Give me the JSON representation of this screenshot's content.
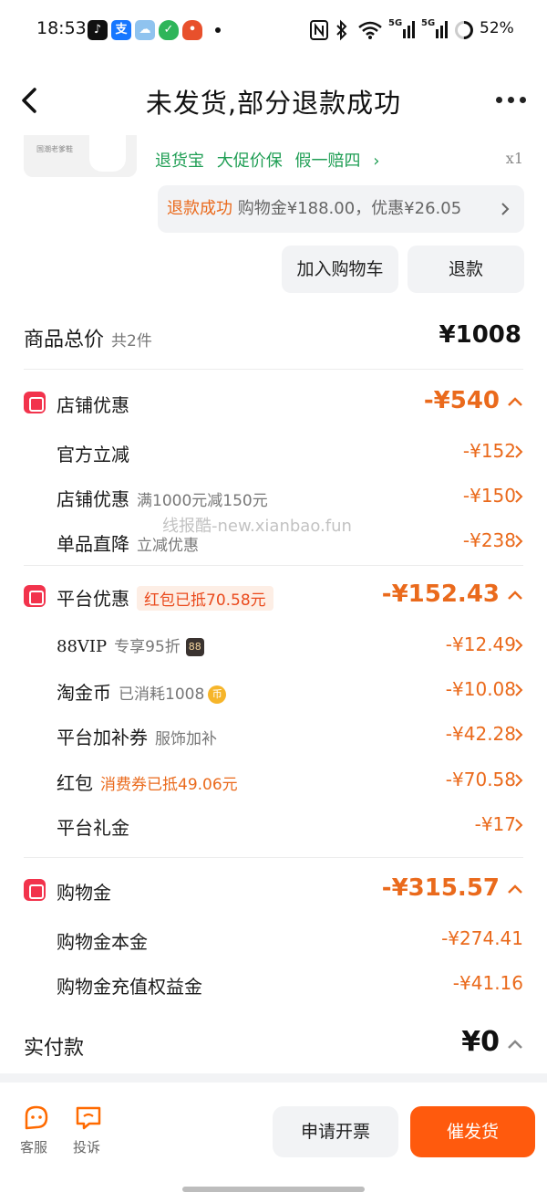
{
  "status_bar": {
    "time": "18:53",
    "battery": "52%",
    "signal_labels": [
      "5G",
      "5G"
    ],
    "app_icons": [
      "tiktok-icon",
      "alipay-icon",
      "weather-icon",
      "security-icon",
      "taobao-icon"
    ]
  },
  "header": {
    "title": "未发货,部分退款成功"
  },
  "product": {
    "thumb_text": "国潮老爹鞋",
    "tags": [
      "退货宝",
      "大促价保",
      "假一赔四"
    ],
    "quantity": "x1"
  },
  "refund": {
    "status": "退款成功",
    "detail": "购物金¥188.00，优惠¥26.05"
  },
  "actions": {
    "add_cart": "加入购物车",
    "refund": "退款"
  },
  "summary": {
    "label": "商品总价",
    "count": "共2件",
    "amount": "¥1008"
  },
  "store_discount": {
    "label": "店铺优惠",
    "amount": "-¥540",
    "items": [
      {
        "label": "官方立减",
        "note": "",
        "amount": "-¥152"
      },
      {
        "label": "店铺优惠",
        "note": "满1000元减150元",
        "amount": "-¥150"
      },
      {
        "label": "单品直降",
        "note": "立减优惠",
        "amount": "-¥238"
      }
    ]
  },
  "watermark": "线报酷-new.xianbao.fun",
  "platform_discount": {
    "label": "平台优惠",
    "tag": "红包已抵70.58元",
    "amount": "-¥152.43",
    "items": [
      {
        "label": "88VIP",
        "note": "专享95折",
        "badge": "88",
        "amount": "-¥12.49"
      },
      {
        "label": "淘金币",
        "note": "已消耗1008",
        "coin": "币",
        "amount": "-¥10.08"
      },
      {
        "label": "平台加补券",
        "note": "服饰加补",
        "amount": "-¥42.28"
      },
      {
        "label": "红包",
        "note_orange": "消费券已抵49.06元",
        "amount": "-¥70.58"
      },
      {
        "label": "平台礼金",
        "note": "",
        "amount": "-¥17"
      }
    ]
  },
  "shopping_credit": {
    "label": "购物金",
    "amount": "-¥315.57",
    "items": [
      {
        "label": "购物金本金",
        "amount": "-¥274.41"
      },
      {
        "label": "购物金充值权益金",
        "amount": "-¥41.16"
      }
    ]
  },
  "paid": {
    "label": "实付款",
    "amount": "¥0"
  },
  "bottom_bar": {
    "service": "客服",
    "complain": "投诉",
    "invoice": "申请开票",
    "urge": "催发货"
  },
  "colors": {
    "accent": "#ea6a1c",
    "primary_button": "#ff5a0d",
    "tag_green": "#1f9e54",
    "section_icon": "#f2334c"
  }
}
